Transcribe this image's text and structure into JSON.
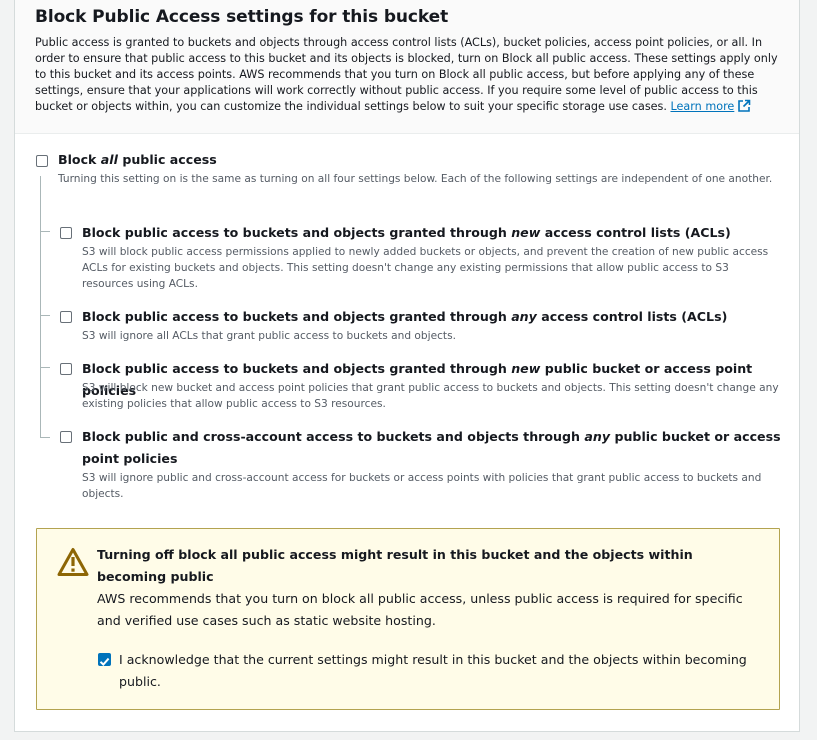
{
  "section": {
    "title": "Block Public Access settings for this bucket",
    "description": "Public access is granted to buckets and objects through access control lists (ACLs), bucket policies, access point policies, or all. In order to ensure that public access to this bucket and its objects is blocked, turn on Block all public access. These settings apply only to this bucket and its access points. AWS recommends that you turn on Block all public access, but before applying any of these settings, ensure that your applications will work correctly without public access. If you require some level of public access to this bucket or objects within, you can customize the individual settings below to suit your specific storage use cases.",
    "learn_more": "Learn more",
    "link_icon": "external-link-icon"
  },
  "block_all": {
    "label_pre": "Block ",
    "label_em": "all",
    "label_post": " public access",
    "checked": false,
    "description": "Turning this setting on is the same as turning on all four settings below. Each of the following settings are independent of one another."
  },
  "options": [
    {
      "label_pre": "Block public access to buckets and objects granted through ",
      "label_em": "new",
      "label_post": " access control lists (ACLs)",
      "checked": false,
      "description": "S3 will block public access permissions applied to newly added buckets or objects, and prevent the creation of new public access ACLs for existing buckets and objects. This setting doesn't change any existing permissions that allow public access to S3 resources using ACLs."
    },
    {
      "label_pre": "Block public access to buckets and objects granted through ",
      "label_em": "any",
      "label_post": " access control lists (ACLs)",
      "checked": false,
      "description": "S3 will ignore all ACLs that grant public access to buckets and objects."
    },
    {
      "label_pre": "Block public access to buckets and objects granted through ",
      "label_em": "new",
      "label_post": " public bucket or access point policies",
      "checked": false,
      "description": "S3 will block new bucket and access point policies that grant public access to buckets and objects. This setting doesn't change any existing policies that allow public access to S3 resources."
    },
    {
      "label_pre": "Block public and cross-account access to buckets and objects through ",
      "label_em": "any",
      "label_post": " public bucket or access point policies",
      "checked": false,
      "description": "S3 will ignore public and cross-account access for buckets or access points with policies that grant public access to buckets and objects."
    }
  ],
  "warning": {
    "icon": "warning-icon",
    "title": "Turning off block all public access might result in this bucket and the objects within becoming public",
    "body": "AWS recommends that you turn on block all public access, unless public access is required for specific and verified use cases such as static website hosting.",
    "acknowledge": "I acknowledge that the current settings might result in this bucket and the objects within becoming public.",
    "acknowledged": true
  },
  "colors": {
    "link": "#0073bb",
    "checkbox_checked": "#0073bb",
    "warning_bg": "#fffce8",
    "warning_border": "#b3a350",
    "warning_icon": "#8d6605"
  }
}
